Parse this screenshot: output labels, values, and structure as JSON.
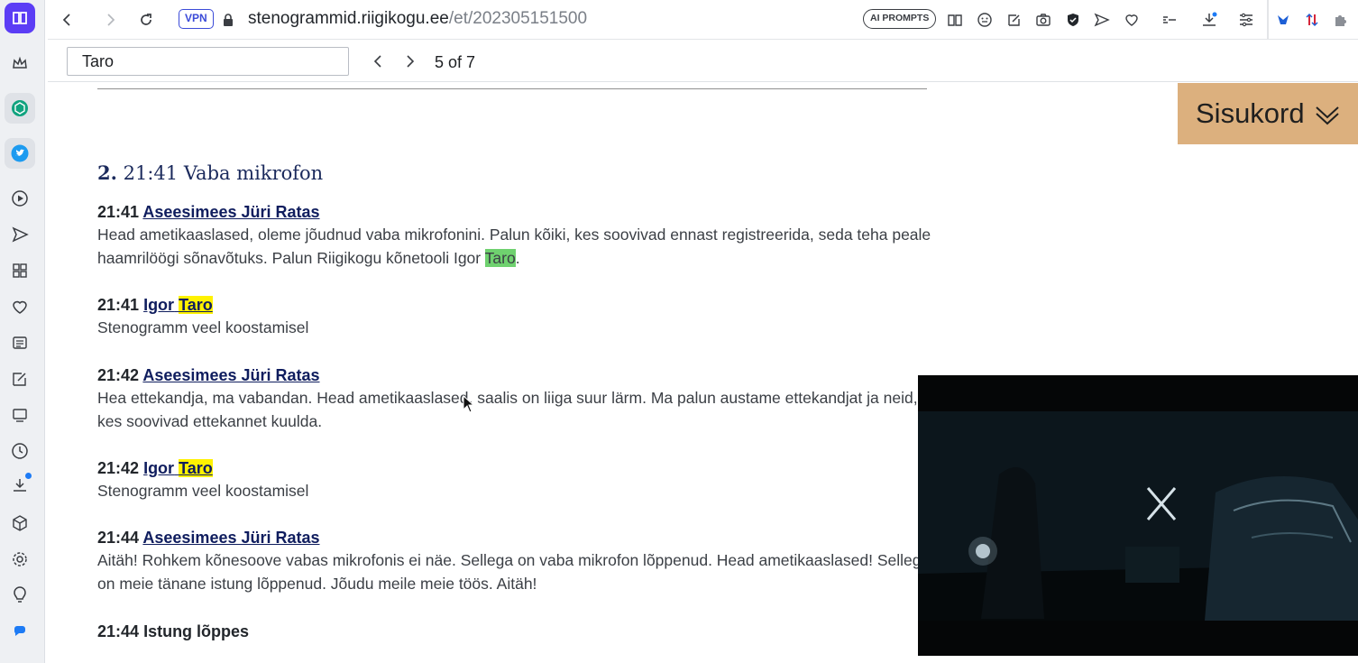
{
  "browser": {
    "vpn_label": "VPN",
    "url_host": "stenogrammid.riigikogu.ee",
    "url_path": "/et/202305151500",
    "ai_prompts_label": "AI PROMPTS"
  },
  "find": {
    "query": "Taro",
    "count": "5 of 7"
  },
  "section": {
    "number": "2.",
    "title": "21:41 Vaba mikrofon"
  },
  "entries": [
    {
      "time": "21:41",
      "speaker": "Aseesimees Jüri Ratas",
      "text_before": "Head ametikaaslased, oleme jõudnud vaba mikrofonini. Palun kõiki, kes soovivad ennast registreerida, seda teha peale haamrilöögi sõnavõtuks. Palun Riigikogu kõnetooli Igor ",
      "highlight": "Taro",
      "text_after": "."
    },
    {
      "time": "21:41",
      "speaker_first": "Igor",
      "speaker_highlight": "Taro",
      "text": "Stenogramm veel koostamisel"
    },
    {
      "time": "21:42",
      "speaker": "Aseesimees Jüri Ratas",
      "text": "Hea ettekandja, ma vabandan. Head ametikaaslased, saalis on liiga suur lärm. Ma palun austame ettekandjat ja neid, kes soovivad ettekannet kuulda."
    },
    {
      "time": "21:42",
      "speaker_first": "Igor",
      "speaker_highlight": "Taro",
      "text": "Stenogramm veel koostamisel"
    },
    {
      "time": "21:44",
      "speaker": "Aseesimees Jüri Ratas",
      "text": "Aitäh! Rohkem kõnesoove vabas mikrofonis ei näe. Sellega on vaba mikrofon lõppenud. Head ametikaaslased! Sellega on meie tänane istung lõppenud. Jõudu meile meie töös. Aitäh!"
    },
    {
      "time": "21:44",
      "label": "Istung lõppes"
    }
  ],
  "toc_button": "Sisukord",
  "colors": {
    "toc_bg": "#dcb07e",
    "highlight_current": "#6fd16f",
    "highlight_other": "#fff200",
    "link": "#0f1d5e",
    "vpn": "#3b4bd8"
  }
}
